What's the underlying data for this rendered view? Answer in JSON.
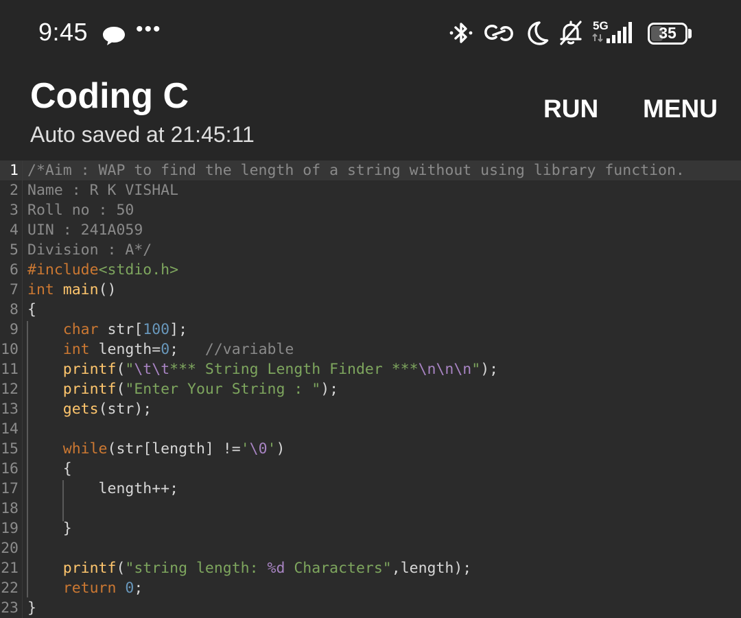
{
  "status_bar": {
    "time": "9:45",
    "more_dots": "•••",
    "battery_percent": "35",
    "battery_level": 0.35,
    "network_label": "5G",
    "icons": [
      "chat-bubble-icon",
      "bluetooth-icon",
      "link-icon",
      "moon-icon",
      "bell-off-icon",
      "signal-icon",
      "battery-icon"
    ]
  },
  "header": {
    "title": "Coding C",
    "subtitle": "Auto saved at 21:45:11",
    "run_label": "RUN",
    "menu_label": "MENU"
  },
  "colors": {
    "background": "#2b2b2b",
    "header_background": "#262626",
    "comment": "#8a8a8a",
    "keyword": "#cc7832",
    "function": "#ffc66d",
    "number": "#6897bb",
    "string": "#7ea65e",
    "escape": "#a884c3"
  },
  "editor": {
    "active_line": 1,
    "lines": [
      {
        "number": "1",
        "tokens": [
          {
            "t": "/*Aim : WAP to find the length of a string without using library function.",
            "c": "comment"
          }
        ]
      },
      {
        "number": "2",
        "tokens": [
          {
            "t": "Name : R K VISHAL",
            "c": "comment"
          }
        ]
      },
      {
        "number": "3",
        "tokens": [
          {
            "t": "Roll no : 50",
            "c": "comment"
          }
        ]
      },
      {
        "number": "4",
        "tokens": [
          {
            "t": "UIN : 241A059",
            "c": "comment"
          }
        ]
      },
      {
        "number": "5",
        "tokens": [
          {
            "t": "Division : A*/",
            "c": "comment"
          }
        ]
      },
      {
        "number": "6",
        "tokens": [
          {
            "t": "#include",
            "c": "include"
          },
          {
            "t": "<stdio.h>",
            "c": "header"
          }
        ]
      },
      {
        "number": "7",
        "tokens": [
          {
            "t": "int",
            "c": "keyword"
          },
          {
            "t": " ",
            "c": "plain"
          },
          {
            "t": "main",
            "c": "func"
          },
          {
            "t": "()",
            "c": "plain"
          }
        ]
      },
      {
        "number": "8",
        "tokens": [
          {
            "t": "{",
            "c": "plain"
          }
        ]
      },
      {
        "number": "9",
        "tokens": [
          {
            "t": "    ",
            "c": "plain"
          },
          {
            "t": "char",
            "c": "keyword"
          },
          {
            "t": " str[",
            "c": "plain"
          },
          {
            "t": "100",
            "c": "num"
          },
          {
            "t": "];",
            "c": "plain"
          }
        ]
      },
      {
        "number": "10",
        "tokens": [
          {
            "t": "    ",
            "c": "plain"
          },
          {
            "t": "int",
            "c": "keyword"
          },
          {
            "t": " length=",
            "c": "plain"
          },
          {
            "t": "0",
            "c": "num"
          },
          {
            "t": ";   ",
            "c": "plain"
          },
          {
            "t": "//variable",
            "c": "comment"
          }
        ]
      },
      {
        "number": "11",
        "tokens": [
          {
            "t": "    ",
            "c": "plain"
          },
          {
            "t": "printf",
            "c": "func"
          },
          {
            "t": "(",
            "c": "plain"
          },
          {
            "t": "\"",
            "c": "string"
          },
          {
            "t": "\\t\\t",
            "c": "escape"
          },
          {
            "t": "*** String Length Finder ***",
            "c": "string"
          },
          {
            "t": "\\n\\n\\n",
            "c": "escape"
          },
          {
            "t": "\"",
            "c": "string"
          },
          {
            "t": ");",
            "c": "plain"
          }
        ]
      },
      {
        "number": "12",
        "tokens": [
          {
            "t": "    ",
            "c": "plain"
          },
          {
            "t": "printf",
            "c": "func"
          },
          {
            "t": "(",
            "c": "plain"
          },
          {
            "t": "\"Enter Your String : \"",
            "c": "string"
          },
          {
            "t": ");",
            "c": "plain"
          }
        ]
      },
      {
        "number": "13",
        "tokens": [
          {
            "t": "    ",
            "c": "plain"
          },
          {
            "t": "gets",
            "c": "func"
          },
          {
            "t": "(str);",
            "c": "plain"
          }
        ]
      },
      {
        "number": "14",
        "tokens": [
          {
            "t": "",
            "c": "plain"
          }
        ]
      },
      {
        "number": "15",
        "tokens": [
          {
            "t": "    ",
            "c": "plain"
          },
          {
            "t": "while",
            "c": "keyword"
          },
          {
            "t": "(str[length] !=",
            "c": "plain"
          },
          {
            "t": "'",
            "c": "string"
          },
          {
            "t": "\\0",
            "c": "escape"
          },
          {
            "t": "'",
            "c": "string"
          },
          {
            "t": ")",
            "c": "plain"
          }
        ]
      },
      {
        "number": "16",
        "tokens": [
          {
            "t": "    {",
            "c": "plain"
          }
        ]
      },
      {
        "number": "17",
        "tokens": [
          {
            "t": "        length++;",
            "c": "plain"
          }
        ]
      },
      {
        "number": "18",
        "tokens": [
          {
            "t": "",
            "c": "plain"
          }
        ]
      },
      {
        "number": "19",
        "tokens": [
          {
            "t": "    }",
            "c": "plain"
          }
        ]
      },
      {
        "number": "20",
        "tokens": [
          {
            "t": "",
            "c": "plain"
          }
        ]
      },
      {
        "number": "21",
        "tokens": [
          {
            "t": "    ",
            "c": "plain"
          },
          {
            "t": "printf",
            "c": "func"
          },
          {
            "t": "(",
            "c": "plain"
          },
          {
            "t": "\"string length: ",
            "c": "string"
          },
          {
            "t": "%d",
            "c": "escape"
          },
          {
            "t": " Characters\"",
            "c": "string"
          },
          {
            "t": ",length);",
            "c": "plain"
          }
        ]
      },
      {
        "number": "22",
        "tokens": [
          {
            "t": "    ",
            "c": "plain"
          },
          {
            "t": "return",
            "c": "keyword"
          },
          {
            "t": " ",
            "c": "plain"
          },
          {
            "t": "0",
            "c": "num"
          },
          {
            "t": ";",
            "c": "plain"
          }
        ]
      },
      {
        "number": "23",
        "tokens": [
          {
            "t": "}",
            "c": "plain"
          }
        ]
      }
    ]
  }
}
